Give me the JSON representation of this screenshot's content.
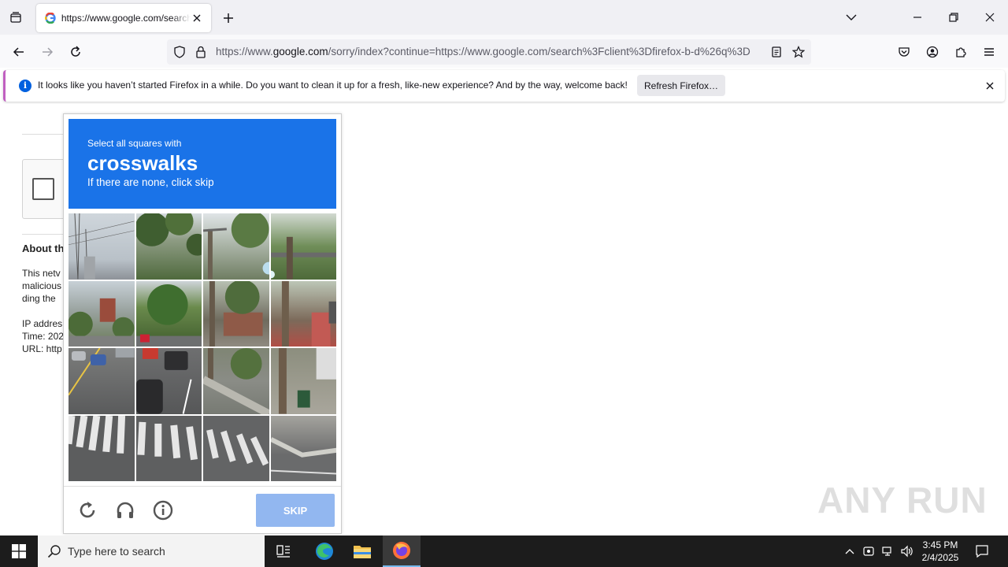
{
  "browser": {
    "tab_title": "https://www.google.com/search?client=firefox-b-d&q",
    "url_prefix": "https://www.",
    "url_domain": "google.com",
    "url_rest": "/sorry/index?continue=https://www.google.com/search%3Fclient%3Dfirefox-b-d%26q%3D"
  },
  "infobar": {
    "message": "It looks like you haven’t started Firefox in a while. Do you want to clean it up for a fresh, like-new experience? And by the way, welcome back!",
    "button_label": "Refresh Firefox…"
  },
  "background_page": {
    "about_heading": "About th",
    "lines": [
      "This netv",
      "malicious",
      "ding the"
    ],
    "ip_label": "IP addres",
    "time_label": "Time: 202",
    "url_label": "URL: http"
  },
  "challenge": {
    "instruction_small": "Select all squares with",
    "target": "crosswalks",
    "instruction_sub": "If there are none, click skip",
    "skip_label": "SKIP"
  },
  "taskbar": {
    "search_placeholder": "Type here to search",
    "time": "3:45 PM",
    "date": "2/4/2025"
  },
  "watermark": "ANY RUN",
  "colors": {
    "challenge_blue": "#1a73e8",
    "skip_disabled": "#92b7f0",
    "info_blue": "#0060df"
  }
}
